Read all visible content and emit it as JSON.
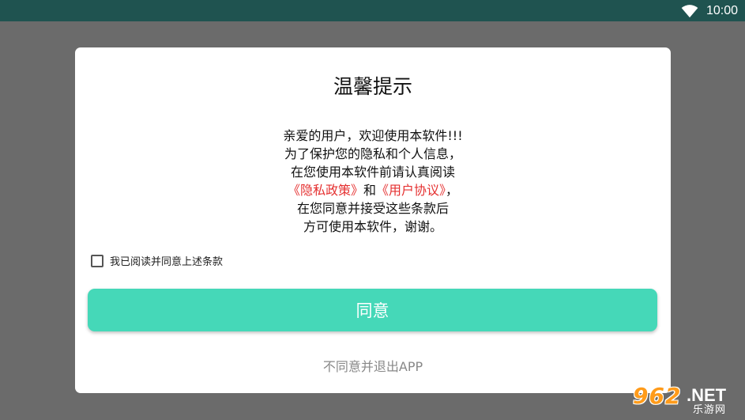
{
  "status_bar": {
    "time": "10:00",
    "wifi_icon": "wifi-icon"
  },
  "dialog": {
    "title": "温馨提示",
    "message": {
      "line1": "亲爱的用户，欢迎使用本软件!!!",
      "line2": "为了保护您的隐私和个人信息，",
      "line3": "在您使用本软件前请认真阅读",
      "privacy_link": "《隐私政策》",
      "and": "和",
      "agreement_link": "《用户协议》",
      "comma": "，",
      "line5": "在您同意并接受这些条款后",
      "line6": "方可使用本软件，谢谢。"
    },
    "checkbox_label": "我已阅读并同意上述条款",
    "checkbox_checked": false,
    "agree_button": "同意",
    "exit_link": "不同意并退出APP"
  },
  "watermark": {
    "brand": "962",
    "domain": ".NET",
    "sub": "乐游网"
  },
  "colors": {
    "status_bar": "#1f5350",
    "overlay": "#6b6b6b",
    "accent": "#45d8b8",
    "link": "#e53030"
  }
}
